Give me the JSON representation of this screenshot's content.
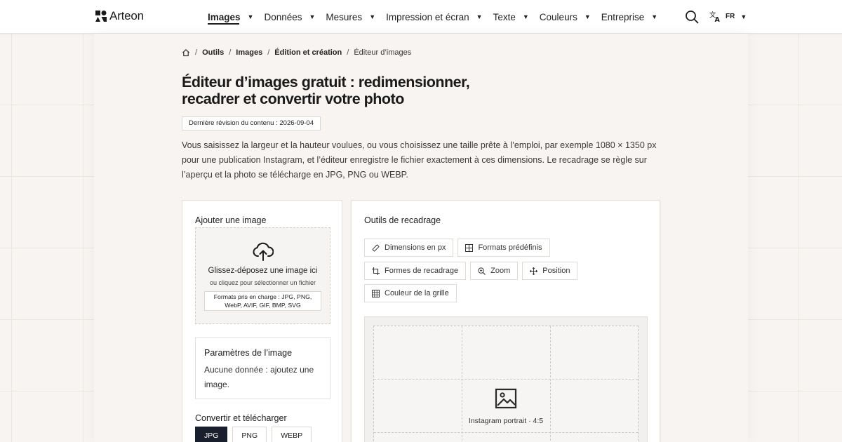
{
  "brand": {
    "name": "Arteon"
  },
  "nav": [
    {
      "label": "Images",
      "active": true
    },
    {
      "label": "Données"
    },
    {
      "label": "Mesures"
    },
    {
      "label": "Impression et écran"
    },
    {
      "label": "Texte"
    },
    {
      "label": "Couleurs"
    },
    {
      "label": "Entreprise"
    }
  ],
  "lang": {
    "code": "FR"
  },
  "breadcrumb": {
    "items": [
      "Outils",
      "Images",
      "Édition et création"
    ],
    "current": "Éditeur d’images"
  },
  "page": {
    "title_line1": "Éditeur d’images gratuit : redimensionner,",
    "title_line2": "recadrer et convertir votre photo",
    "revision": "Dernière révision du contenu : 2026-09-04",
    "intro": "Vous saisissez la largeur et la hauteur voulues, ou vous choisissez une taille prête à l’emploi, par exemple 1080 × 1350 px pour une publication Instagram, et l’éditeur enregistre le fichier exactement à ces dimensions. Le recadrage se règle sur l’aperçu et la photo se télécharge en JPG, PNG ou WEBP."
  },
  "upload": {
    "title": "Ajouter une image",
    "main": "Glissez-déposez une image ici",
    "sub": "ou cliquez pour sélectionner un fichier",
    "formats_line1": "Formats pris en charge : JPG, PNG,",
    "formats_line2": "WebP, AVIF, GIF, BMP, SVG"
  },
  "params": {
    "title": "Paramètres de l’image",
    "empty": "Aucune donnée : ajoutez une image."
  },
  "convert": {
    "title": "Convertir et télécharger",
    "formats": [
      "JPG",
      "PNG",
      "WEBP"
    ],
    "selected": "JPG"
  },
  "crop": {
    "title": "Outils de recadrage",
    "tools": {
      "dimensions": "Dimensions en px",
      "presets": "Formats prédéfinis",
      "shapes": "Formes de recadrage",
      "zoom": "Zoom",
      "position": "Position",
      "grid_color": "Couleur de la grille"
    },
    "preview_label": "Instagram portrait · 4:5"
  },
  "colors": {
    "accent": "#1a1f2e",
    "background": "#f7f4f1"
  }
}
